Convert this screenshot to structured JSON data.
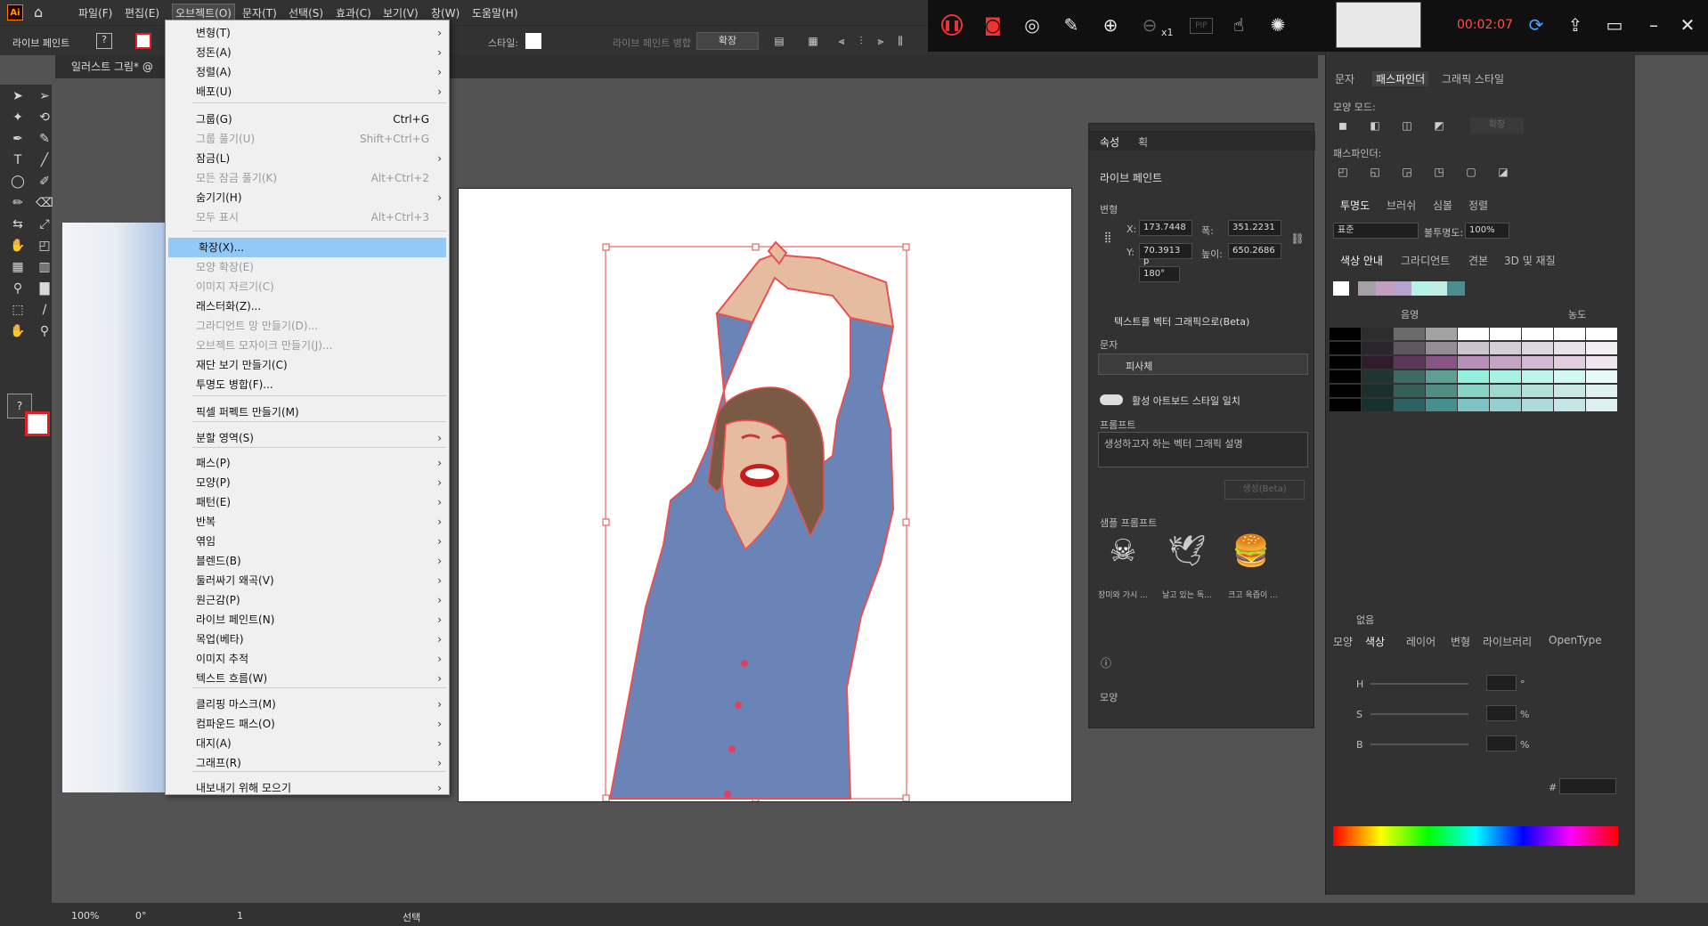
{
  "app": {
    "logo": "Ai",
    "menus": [
      "파일(F)",
      "편집(E)",
      "오브젝트(O)",
      "문자(T)",
      "선택(S)",
      "효과(C)",
      "보기(V)",
      "창(W)",
      "도움말(H)"
    ],
    "active_menu": "오브젝트(O)"
  },
  "control_bar": {
    "mode_label": "라이브 페인트",
    "style_label": "스타일:",
    "live_paint_merge_label": "라이브 페인트 병합",
    "expand_button": "확장"
  },
  "document": {
    "tab_title": "일러스트 그림* @"
  },
  "object_menu": {
    "items": [
      {
        "label": "변형(T)",
        "shortcut": "",
        "submenu": true,
        "enabled": true
      },
      {
        "label": "정돈(A)",
        "shortcut": "",
        "submenu": true,
        "enabled": true
      },
      {
        "label": "정렬(A)",
        "shortcut": "",
        "submenu": true,
        "enabled": true
      },
      {
        "label": "배포(U)",
        "shortcut": "",
        "submenu": true,
        "enabled": true
      },
      {
        "label": "그룹(G)",
        "shortcut": "Ctrl+G",
        "submenu": false,
        "enabled": true
      },
      {
        "label": "그룹 풀기(U)",
        "shortcut": "Shift+Ctrl+G",
        "submenu": false,
        "enabled": false
      },
      {
        "label": "잠금(L)",
        "shortcut": "",
        "submenu": true,
        "enabled": true
      },
      {
        "label": "모든 잠금 풀기(K)",
        "shortcut": "Alt+Ctrl+2",
        "submenu": false,
        "enabled": false
      },
      {
        "label": "숨기기(H)",
        "shortcut": "",
        "submenu": true,
        "enabled": true
      },
      {
        "label": "모두 표시",
        "shortcut": "Alt+Ctrl+3",
        "submenu": false,
        "enabled": false
      },
      {
        "label": "확장(X)...",
        "shortcut": "",
        "submenu": false,
        "enabled": true,
        "highlight": true
      },
      {
        "label": "모양 확장(E)",
        "shortcut": "",
        "submenu": false,
        "enabled": false
      },
      {
        "label": "이미지 자르기(C)",
        "shortcut": "",
        "submenu": false,
        "enabled": false
      },
      {
        "label": "래스터화(Z)...",
        "shortcut": "",
        "submenu": false,
        "enabled": true
      },
      {
        "label": "그라디언트 망 만들기(D)...",
        "shortcut": "",
        "submenu": false,
        "enabled": false
      },
      {
        "label": "오브젝트 모자이크 만들기(J)...",
        "shortcut": "",
        "submenu": false,
        "enabled": false
      },
      {
        "label": "재단 보기 만들기(C)",
        "shortcut": "",
        "submenu": false,
        "enabled": true
      },
      {
        "label": "투명도 병합(F)...",
        "shortcut": "",
        "submenu": false,
        "enabled": true
      },
      {
        "label": "픽셀 퍼펙트 만들기(M)",
        "shortcut": "",
        "submenu": false,
        "enabled": true
      },
      {
        "label": "분할 영역(S)",
        "shortcut": "",
        "submenu": true,
        "enabled": true
      },
      {
        "label": "패스(P)",
        "shortcut": "",
        "submenu": true,
        "enabled": true
      },
      {
        "label": "모양(P)",
        "shortcut": "",
        "submenu": true,
        "enabled": true
      },
      {
        "label": "패턴(E)",
        "shortcut": "",
        "submenu": true,
        "enabled": true
      },
      {
        "label": "반복",
        "shortcut": "",
        "submenu": true,
        "enabled": true
      },
      {
        "label": "엮임",
        "shortcut": "",
        "submenu": true,
        "enabled": true
      },
      {
        "label": "블렌드(B)",
        "shortcut": "",
        "submenu": true,
        "enabled": true
      },
      {
        "label": "둘러싸기 왜곡(V)",
        "shortcut": "",
        "submenu": true,
        "enabled": true
      },
      {
        "label": "원근감(P)",
        "shortcut": "",
        "submenu": true,
        "enabled": true
      },
      {
        "label": "라이브 페인트(N)",
        "shortcut": "",
        "submenu": true,
        "enabled": true
      },
      {
        "label": "목업(베타)",
        "shortcut": "",
        "submenu": true,
        "enabled": true
      },
      {
        "label": "이미지 추적",
        "shortcut": "",
        "submenu": true,
        "enabled": true
      },
      {
        "label": "텍스트 흐름(W)",
        "shortcut": "",
        "submenu": true,
        "enabled": true
      },
      {
        "label": "클리핑 마스크(M)",
        "shortcut": "",
        "submenu": true,
        "enabled": true
      },
      {
        "label": "컴파운드 패스(O)",
        "shortcut": "",
        "submenu": true,
        "enabled": true
      },
      {
        "label": "대지(A)",
        "shortcut": "",
        "submenu": true,
        "enabled": true
      },
      {
        "label": "그래프(R)",
        "shortcut": "",
        "submenu": true,
        "enabled": true
      },
      {
        "label": "내보내기 위해 모으기",
        "shortcut": "",
        "submenu": true,
        "enabled": true
      }
    ]
  },
  "recorder": {
    "time": "00:02:07",
    "zoom_label": "x1",
    "pip_label": "PIP"
  },
  "properties_panel": {
    "tabs": [
      "속성",
      "획"
    ],
    "section_title": "라이브 페인트",
    "transform_label": "변형",
    "x_label": "X:",
    "x_value": "173.7448",
    "y_label": "Y:",
    "y_value": "70.3913 p",
    "w_label": "폭:",
    "w_value": "351.2231",
    "h_label": "높이:",
    "h_value": "650.2686",
    "angle_value": "180°",
    "text_to_vector_label": "텍스트를 벡터 그래픽으로(Beta)",
    "type_label": "문자",
    "subject_value": "피사체",
    "match_style_label": "활성 아트보드 스타일 일치",
    "prompt_label": "프롬프트",
    "prompt_placeholder": "생성하고자 하는 벡터 그래픽 설명",
    "generate_label": "생성(Beta)",
    "samples_label": "샘플 프롬프트",
    "samples": [
      "장미와 가시 ...",
      "날고 있는 독...",
      "크고 육즙이 ..."
    ],
    "appearance_label": "모양"
  },
  "right_panel": {
    "top_tabs": [
      "문자",
      "패스파인더",
      "그래픽 스타일"
    ],
    "shape_modes_label": "모양 모드:",
    "expand_label": "확장",
    "pathfinder_label": "패스파인더:",
    "transparency_tabs": [
      "투명도",
      "브러쉬",
      "심볼",
      "정렬"
    ],
    "blend_mode": "표준",
    "opacity_label": "불투명도:",
    "opacity_value": "100%",
    "color_guide_tabs": [
      "색상 안내",
      "그라디언트",
      "견본",
      "3D 및 재질"
    ],
    "shade_label": "음영",
    "tint_label": "농도",
    "none_label": "없음",
    "color_tabs": [
      "모양",
      "색상",
      "레이어",
      "변형",
      "라이브러리",
      "OpenType"
    ],
    "h_label": "H",
    "s_label": "S",
    "b_label": "B",
    "degree_unit": "°",
    "percent_unit": "%",
    "hash_label": "#",
    "swatch_colors": [
      "#ffffff",
      "#a5a0a8",
      "#c49ec0",
      "#b4a4cf",
      "#b6f3e7",
      "#c0ece4",
      "#4d8d8d"
    ],
    "guide_rows": [
      [
        "#000000",
        "#2d2d2d",
        "#6b6b6b",
        "#a2a2a2",
        "#ffffff",
        "#ffffff",
        "#ffffff",
        "#ffffff",
        "#ffffff"
      ],
      [
        "#000000",
        "#2b252d",
        "#5e5760",
        "#948c96",
        "#cbc4cd",
        "#d4ced6",
        "#ddd8df",
        "#e7e2e8",
        "#f1eef2"
      ],
      [
        "#000000",
        "#2f1d2e",
        "#5b385a",
        "#885486",
        "#b88fb6",
        "#c5a3c3",
        "#d3b8d2",
        "#e1cde0",
        "#efe4ef"
      ],
      [
        "#000000",
        "#203531",
        "#3f6a62",
        "#5e9f93",
        "#93f0df",
        "#a7f2e5",
        "#bcf5eb",
        "#d1f8f1",
        "#e6fbf7"
      ],
      [
        "#000000",
        "#1b2f2c",
        "#365e58",
        "#528d84",
        "#88d2c6",
        "#9dd9cf",
        "#b3e1d9",
        "#c8e9e3",
        "#def1ee"
      ],
      [
        "#000000",
        "#173131",
        "#2e6060",
        "#468f8f",
        "#7fc4c4",
        "#96cfcf",
        "#aedada",
        "#c5e5e5",
        "#dcf0f0"
      ]
    ]
  },
  "status_bar": {
    "zoom": "100%",
    "rotation": "0°",
    "artboard_number": "1",
    "tool": "선택"
  },
  "colors": {
    "figure_shirt": "#6a84b8",
    "figure_skin": "#e6bca0",
    "figure_hair": "#7a5a45",
    "selection": "#e04848",
    "stroke_outline": "#e85050"
  }
}
